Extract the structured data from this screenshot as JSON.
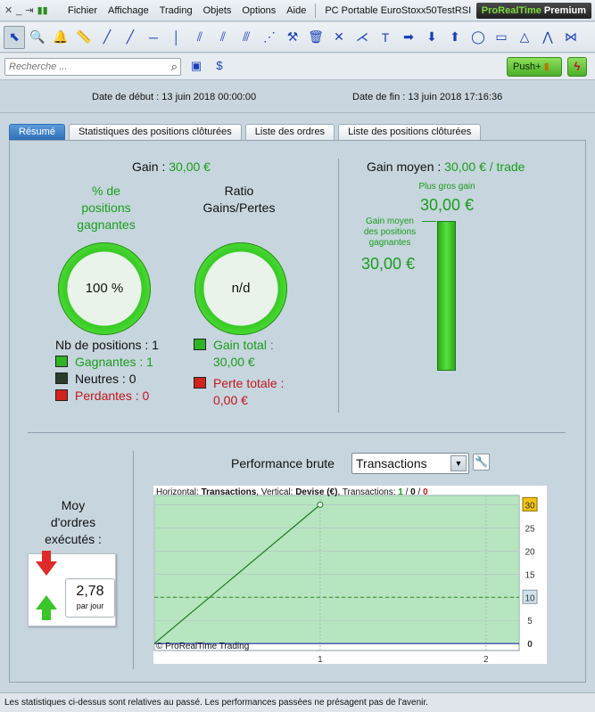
{
  "menubar": {
    "items": [
      "Fichier",
      "Affichage",
      "Trading",
      "Objets",
      "Options",
      "Aide"
    ],
    "document_title": "PC Portable EuroStoxx50TestRSI",
    "premium_brand": "ProRealTime",
    "premium_label": "Premium"
  },
  "toolbar": {
    "tools": [
      {
        "name": "pointer-icon",
        "glyph": "⬉"
      },
      {
        "name": "zoom-icon",
        "glyph": "🔍"
      },
      {
        "name": "alarm-icon",
        "glyph": "🔔"
      },
      {
        "name": "ruler-icon",
        "glyph": "📏"
      },
      {
        "name": "segment-icon",
        "glyph": "╱"
      },
      {
        "name": "line-icon",
        "glyph": "╱"
      },
      {
        "name": "horizontal-line-icon",
        "glyph": "─"
      },
      {
        "name": "vertical-line-icon",
        "glyph": "│"
      },
      {
        "name": "channel-icon",
        "glyph": "⫽"
      },
      {
        "name": "parallel-lines-icon",
        "glyph": "⫽"
      },
      {
        "name": "regression-icon",
        "glyph": "⫻"
      },
      {
        "name": "fan-icon",
        "glyph": "⋰"
      },
      {
        "name": "hammer-icon",
        "glyph": "⚒"
      },
      {
        "name": "trash-icon",
        "glyph": "🗑"
      },
      {
        "name": "cross-line-icon",
        "glyph": "✕"
      },
      {
        "name": "andrews-fork-icon",
        "glyph": "⋌"
      },
      {
        "name": "text-icon",
        "glyph": "T"
      },
      {
        "name": "arrow-right-icon",
        "glyph": "➡"
      },
      {
        "name": "arrow-down-icon",
        "glyph": "⬇"
      },
      {
        "name": "arrow-up-icon",
        "glyph": "⬆"
      },
      {
        "name": "ellipse-icon",
        "glyph": "◯"
      },
      {
        "name": "rectangle-icon",
        "glyph": "▭"
      },
      {
        "name": "triangle-icon",
        "glyph": "△"
      },
      {
        "name": "fibonacci-icon",
        "glyph": "⋀"
      },
      {
        "name": "pattern-icon",
        "glyph": "⋈"
      }
    ]
  },
  "search": {
    "placeholder": "Recherche ..."
  },
  "push": {
    "label": "Push+"
  },
  "dates": {
    "start_label": "Date de début :",
    "start_value": "13 juin 2018 00:00:00",
    "end_label": "Date de fin :",
    "end_value": "13 juin 2018 17:16:36"
  },
  "tabs": [
    "Résumé",
    "Statistiques des positions clôturées",
    "Liste des ordres",
    "Liste des positions clôturées"
  ],
  "summary": {
    "gain_label": "Gain :",
    "gain_value": "30,00 €",
    "pct_title_1": "% de",
    "pct_title_2": "positions",
    "pct_title_3": "gagnantes",
    "pct_value": "100 %",
    "ratio_title_1": "Ratio",
    "ratio_title_2": "Gains/Pertes",
    "ratio_value": "n/d",
    "nb_positions": "Nb de positions : 1",
    "gagnantes": "Gagnantes : 1",
    "neutres": "Neutres : 0",
    "perdantes": "Perdantes : 0",
    "gain_total_label": "Gain total :",
    "gain_total_value": "30,00 €",
    "perte_totale_label": "Perte totale :",
    "perte_totale_value": "0,00 €",
    "avg_gain_label": "Gain moyen :",
    "avg_gain_value": "30,00 € / trade",
    "biggest_gain_label": "Plus gros gain",
    "biggest_gain_value": "30,00 €",
    "avg_winning_label_1": "Gain moyen",
    "avg_winning_label_2": "des positions",
    "avg_winning_label_3": "gagnantes",
    "avg_winning_value": "30,00 €",
    "moy_1": "Moy",
    "moy_2": "d'ordres",
    "moy_3": "exécutés :",
    "orders_per_day": "2,78",
    "per_day_label": "par jour"
  },
  "performance": {
    "label": "Performance brute",
    "selected": "Transactions"
  },
  "chart_data": {
    "type": "line",
    "header_prefix": "Horizontal: ",
    "header_horizontal": "Transactions",
    "header_mid": ", Vertical: ",
    "header_vertical": "Devise (€)",
    "header_suffix": ", Transactions: ",
    "tx_green": "1",
    "tx_neutral": "0",
    "tx_red": "0",
    "copyright": "© ProRealTime Trading",
    "x": [
      0,
      1
    ],
    "y": [
      0,
      30
    ],
    "xlim": [
      0,
      2.2
    ],
    "ylim": [
      -1.5,
      32
    ],
    "xticks": [
      1,
      2
    ],
    "yticks": [
      0,
      5,
      10,
      15,
      20,
      25,
      30
    ],
    "highlight_ticks": {
      "top": "30",
      "mid": "10"
    },
    "threshold": 10,
    "colors": {
      "line": "#1e7a1e",
      "fill": "#9fdcab",
      "zero_line": "#1a2fa0"
    }
  },
  "status_text": "Les statistiques ci-dessus sont relatives au passé. Les performances passées ne présagent pas de l'avenir."
}
